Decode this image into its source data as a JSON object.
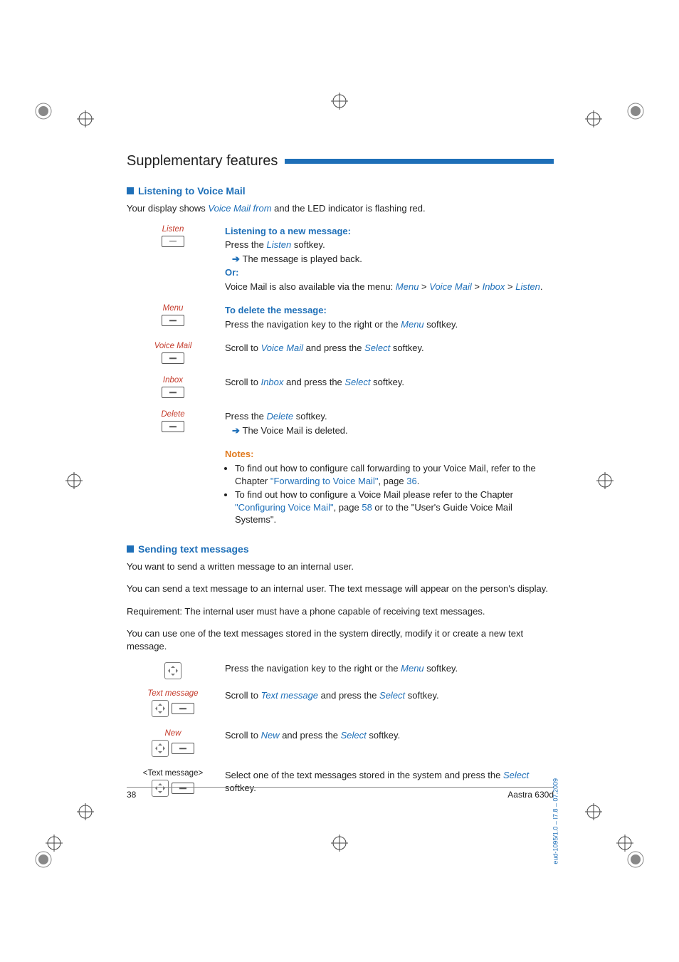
{
  "header": {
    "title": "Supplementary features"
  },
  "section1": {
    "title": "Listening to Voice Mail",
    "intro_pre": "Your display shows ",
    "intro_em": "Voice Mail from",
    "intro_post": " and the LED indicator is flashing red.",
    "steps": {
      "listen": {
        "key": "Listen",
        "h": "Listening to a new message:",
        "l1a": "Press the ",
        "l1b": "Listen",
        "l1c": " softkey.",
        "l2a": "The message is played back.",
        "or": "Or:",
        "l3a": "Voice Mail is also available via the menu: ",
        "p1": "Menu",
        "gt1": " > ",
        "p2": "Voice Mail",
        "gt2": " > ",
        "p3": "Inbox",
        "gt3": " > ",
        "p4": "Listen",
        "dot": "."
      },
      "menu": {
        "key": "Menu",
        "h": "To delete the message:",
        "l1a": "Press the navigation key to the right or the ",
        "l1b": "Menu",
        "l1c": " softkey."
      },
      "vmail": {
        "key": "Voice Mail",
        "l1a": "Scroll to ",
        "l1b": "Voice Mail",
        "l1c": " and press the ",
        "l1d": "Select",
        "l1e": " softkey."
      },
      "inbox": {
        "key": "Inbox",
        "l1a": "Scroll to ",
        "l1b": "Inbox",
        "l1c": " and press the ",
        "l1d": "Select",
        "l1e": " softkey."
      },
      "delete": {
        "key": "Delete",
        "l1a": "Press the ",
        "l1b": "Delete",
        "l1c": " softkey.",
        "l2a": "The Voice Mail is deleted."
      }
    },
    "notes": {
      "h": "Notes:",
      "n1a": "To find out how to configure call forwarding to your Voice Mail, refer to the Chapter ",
      "n1b": "\"Forwarding to Voice Mail\"",
      "n1c": ", page ",
      "n1d": "36",
      "n1e": ".",
      "n2a": "To find out how to configure a Voice Mail please refer to the Chapter ",
      "n2b": "\"Configuring Voice Mail\"",
      "n2c": ", page ",
      "n2d": "58",
      "n2e": " or to the \"User's Guide Voice Mail Systems\"."
    }
  },
  "section2": {
    "title": "Sending text messages",
    "p1": "You want to send a written message to an internal user.",
    "p2": "You can send a text message to an internal user. The text message will appear on the person's display.",
    "p3": "Requirement: The internal user must have a phone capable of receiving text messages.",
    "p4": "You can use one of the text messages stored in the system directly, modify it or create a new text message.",
    "steps": {
      "nav": {
        "l1a": "Press the navigation key to the right or the ",
        "l1b": "Menu",
        "l1c": " softkey."
      },
      "text": {
        "key": "Text message",
        "l1a": "Scroll to ",
        "l1b": "Text message",
        "l1c": " and press the ",
        "l1d": "Select",
        "l1e": " softkey."
      },
      "new": {
        "key": "New",
        "l1a": "Scroll to ",
        "l1b": "New",
        "l1c": " and press the ",
        "l1d": "Select",
        "l1e": " softkey."
      },
      "pick": {
        "key": "<Text message>",
        "l1a": "Select one of the text messages stored in the system and press the ",
        "l1b": "Select",
        "l1c": " softkey."
      }
    }
  },
  "footer": {
    "page": "38",
    "model": "Aastra 630d"
  },
  "docid": "eud-1095/1.0 – I7.8 – 07.2009"
}
